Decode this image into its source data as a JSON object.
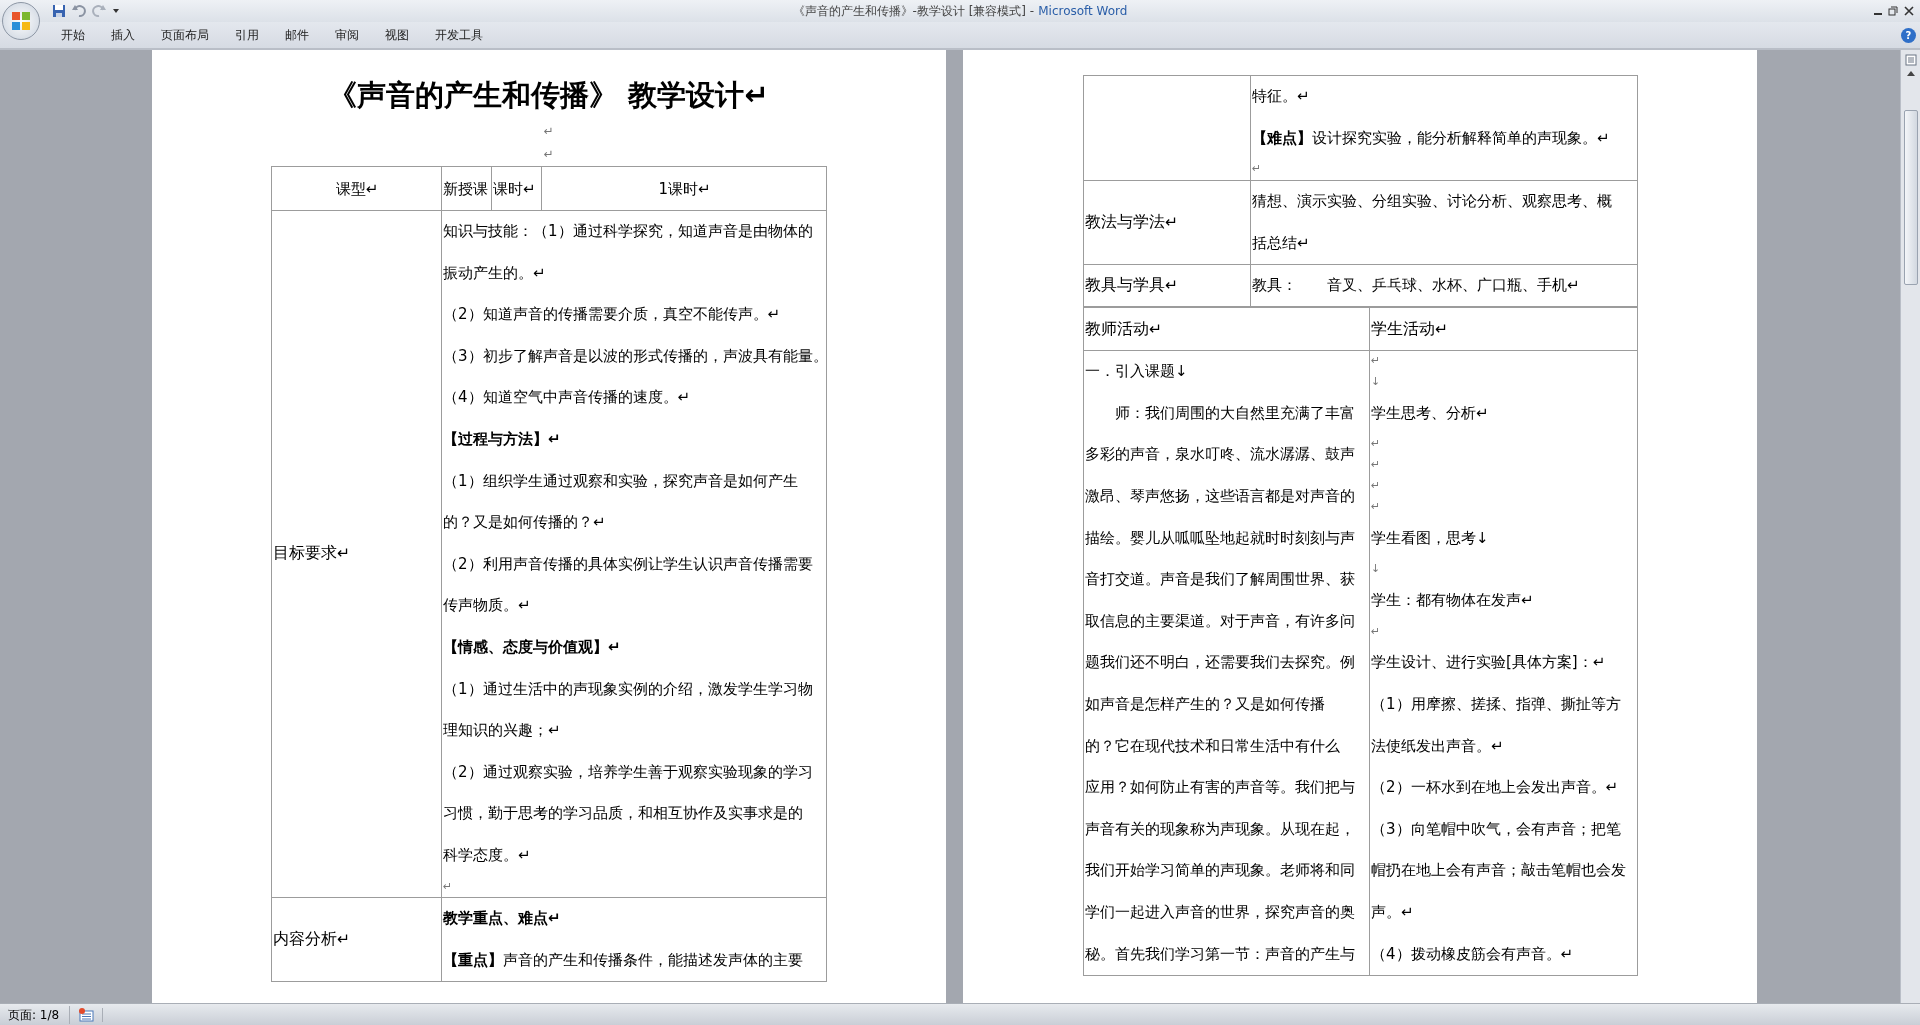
{
  "window": {
    "title": "《声音的产生和传播》-教学设计 [兼容模式] -",
    "app": "Microsoft Word"
  },
  "ribbon_tabs": [
    {
      "label": "开始"
    },
    {
      "label": "插入"
    },
    {
      "label": "页面布局"
    },
    {
      "label": "引用"
    },
    {
      "label": "邮件"
    },
    {
      "label": "审阅"
    },
    {
      "label": "视图"
    },
    {
      "label": "开发工具"
    }
  ],
  "help": "?",
  "left_page": {
    "title": "《声音的产生和传播》 教学设计↵",
    "title_marks": [
      "↵",
      "↵"
    ],
    "header": [
      "课型↵",
      "新授课",
      "课时↵",
      "1课时↵"
    ],
    "rows": [
      {
        "label": "目标要求↵",
        "content": [
          {
            "kind": "text",
            "lines": [
              "知识与技能：（1）通过科学探究，知道声音是由物体的",
              "振动产生的。↵"
            ]
          },
          {
            "kind": "text",
            "lines": [
              "（2）知道声音的传播需要介质，真空不能传声。↵"
            ]
          },
          {
            "kind": "text",
            "lines": [
              "（3）初步了解声音是以波的形式传播的，声波具有能量。"
            ]
          },
          {
            "kind": "text",
            "lines": [
              "（4）知道空气中声音传播的速度。↵"
            ]
          },
          {
            "kind": "text",
            "bold": true,
            "lines": [
              "【过程与方法】↵"
            ]
          },
          {
            "kind": "text",
            "lines": [
              "（1）组织学生通过观察和实验，探究声音是如何产生",
              "的？又是如何传播的？↵"
            ]
          },
          {
            "kind": "text",
            "lines": [
              "（2）利用声音传播的具体实例让学生认识声音传播需要",
              "传声物质。↵"
            ]
          },
          {
            "kind": "text",
            "bold": true,
            "lines": [
              "【情感、态度与价值观】↵"
            ]
          },
          {
            "kind": "text",
            "lines": [
              "（1）通过生活中的声现象实例的介绍，激发学生学习物",
              "理知识的兴趣；↵"
            ]
          },
          {
            "kind": "text",
            "lines": [
              "（2）通过观察实验，培养学生善于观察实验现象的学习",
              "习惯，勤于思考的学习品质，和相互协作及实事求是的",
              "科学态度。↵"
            ]
          },
          {
            "kind": "mark",
            "text": "↵"
          }
        ]
      },
      {
        "label": "内容分析↵",
        "content": [
          {
            "kind": "text",
            "bold": true,
            "lines": [
              "教学重点、难点↵"
            ]
          },
          {
            "kind": "text",
            "lines": [
              "**【重点】**声音的产生和传播条件，能描述发声体的主要"
            ]
          }
        ]
      }
    ]
  },
  "right_page": {
    "rows": [
      {
        "label": "",
        "content": [
          {
            "kind": "text",
            "lines": [
              "特征。↵"
            ]
          },
          {
            "kind": "text",
            "lines": [
              "**【难点】**设计探究实验，能分析解释简单的声现象。↵"
            ]
          },
          {
            "kind": "mark",
            "text": "↵"
          }
        ]
      },
      {
        "label": "教法与学法↵",
        "content": [
          {
            "kind": "text",
            "lines": [
              "猜想、演示实验、分组实验、讨论分析、观察思考、概",
              "括总结↵"
            ]
          }
        ]
      },
      {
        "label": "教具与学具↵",
        "content": [
          {
            "kind": "text",
            "lines": [
              "教具：　　音叉、乒乓球、水杯、广口瓶、手机↵"
            ]
          }
        ]
      }
    ],
    "activity_header": [
      "教师活动↵",
      "学生活动↵"
    ],
    "teacher": [
      {
        "kind": "text",
        "lines": [
          "一．引入课题↓"
        ]
      },
      {
        "kind": "text",
        "indent": true,
        "lines": [
          "师：我们周围的大自然里充满了丰富",
          "多彩的声音，泉水叮咚、流水潺潺、鼓声",
          "激昂、琴声悠扬，这些语言都是对声音的",
          "描绘。婴儿从呱呱坠地起就时时刻刻与声",
          "音打交道。声音是我们了解周围世界、获",
          "取信息的主要渠道。对于声音，有许多问",
          "题我们还不明白，还需要我们去探究。例",
          "如声音是怎样产生的？又是如何传播",
          "的？它在现代技术和日常生活中有什么",
          "应用？如何防止有害的声音等。我们把与",
          "声音有关的现象称为声现象。从现在起，",
          "我们开始学习简单的声现象。老师将和同",
          "学们一起进入声音的世界，探究声音的奥",
          "秘。首先我们学习第一节：声音的产生与"
        ]
      }
    ],
    "student": [
      {
        "kind": "mark",
        "text": "↵"
      },
      {
        "kind": "mark",
        "text": "↓"
      },
      {
        "kind": "text",
        "lines": [
          "学生思考、分析↵"
        ]
      },
      {
        "kind": "mark",
        "text": "↵"
      },
      {
        "kind": "mark",
        "text": "↵"
      },
      {
        "kind": "mark",
        "text": "↵"
      },
      {
        "kind": "mark",
        "text": "↵"
      },
      {
        "kind": "text",
        "lines": [
          "学生看图，思考↓"
        ]
      },
      {
        "kind": "mark",
        "text": "↓"
      },
      {
        "kind": "text",
        "lines": [
          "学生：都有物体在发声↵"
        ]
      },
      {
        "kind": "mark",
        "text": "↵"
      },
      {
        "kind": "text",
        "lines": [
          "学生设计、进行实验[具体方案]：↵"
        ]
      },
      {
        "kind": "text",
        "lines": [
          "（1）用摩擦、搓揉、指弹、撕扯等方",
          "法使纸发出声音。↵"
        ]
      },
      {
        "kind": "text",
        "lines": [
          "（2）一杯水到在地上会发出声音。↵"
        ]
      },
      {
        "kind": "text",
        "lines": [
          "（3）向笔帽中吹气，会有声音；把笔",
          "帽扔在地上会有声音；敲击笔帽也会发",
          "声。↵"
        ]
      },
      {
        "kind": "text",
        "lines": [
          "（4）拨动橡皮筋会有声音。↵"
        ]
      }
    ]
  },
  "status_bar": {
    "page": "页面: 1/8"
  }
}
